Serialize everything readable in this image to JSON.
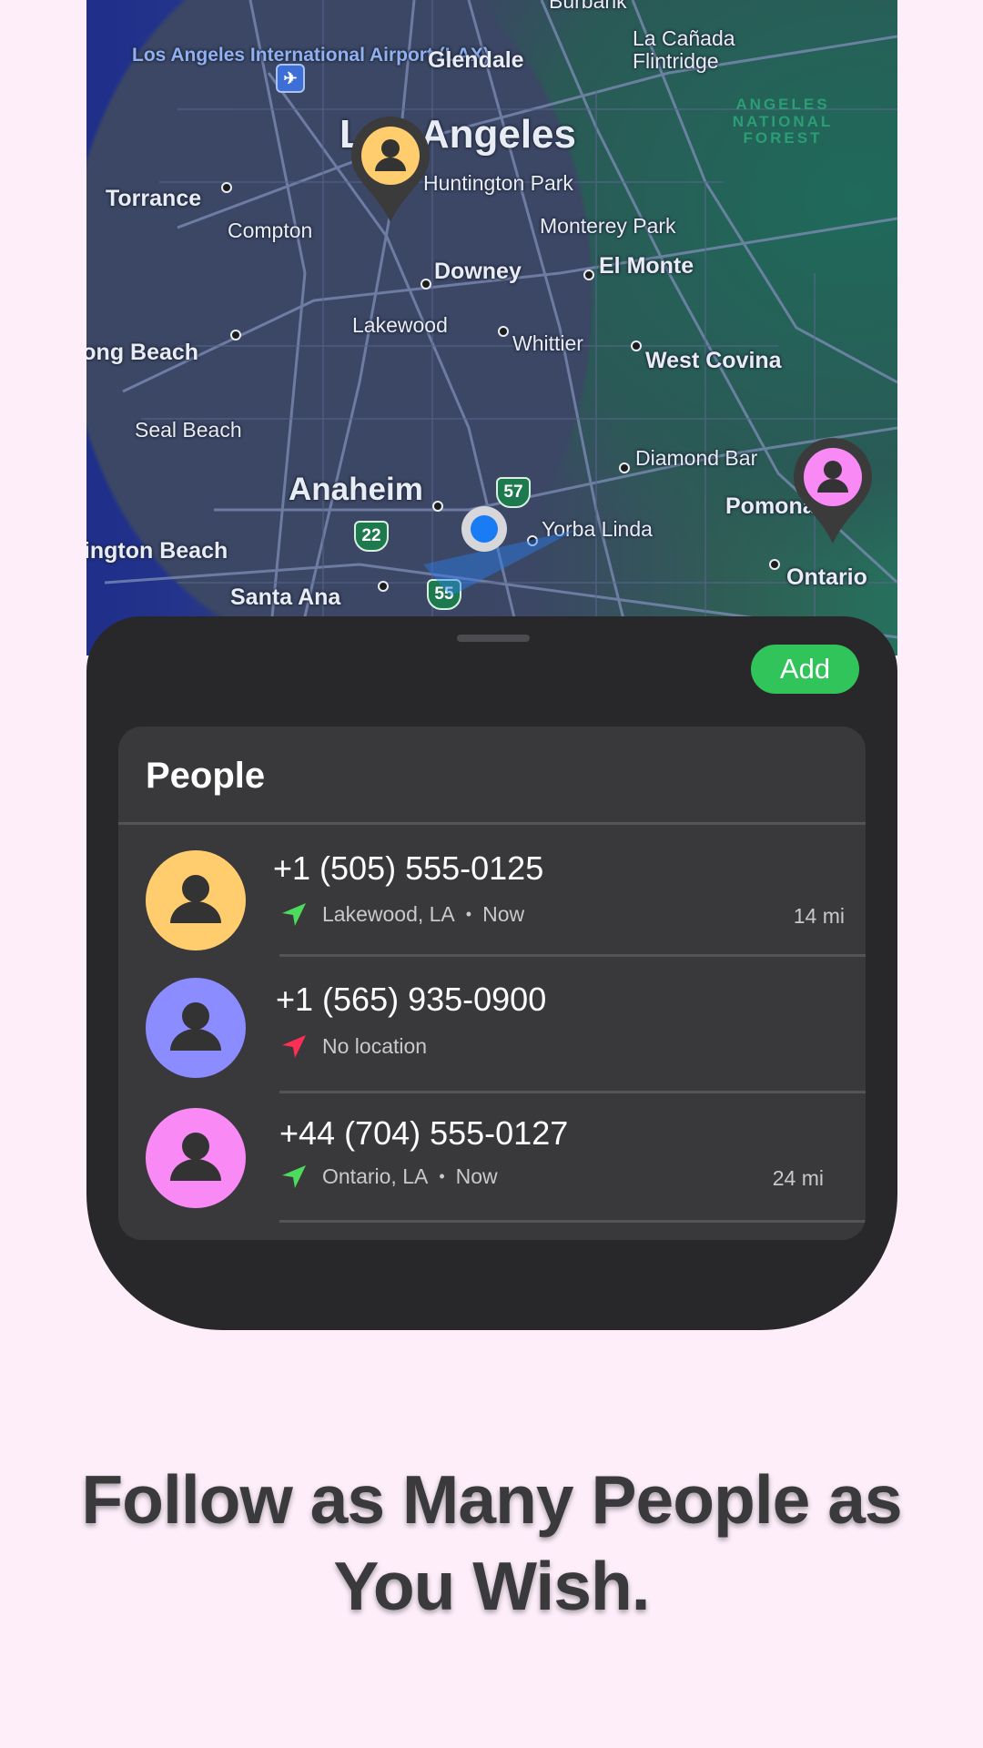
{
  "map": {
    "labels": [
      "Burbank",
      "Los Angeles International Airport (LAX)",
      "Glendale",
      "La Cañada Flintridge",
      "ANGELES NATIONAL FOREST",
      "Los Angeles",
      "Huntington Park",
      "Torrance",
      "Compton",
      "Monterey Park",
      "Downey",
      "El Monte",
      "Lakewood",
      "Whittier",
      "West Covina",
      "Long Beach",
      "Seal Beach",
      "Diamond Bar",
      "Anaheim",
      "Pomona",
      "Yorba Linda",
      "Huntington Beach",
      "Santa Ana",
      "Ontario"
    ],
    "highway_shields": [
      "57",
      "22",
      "55"
    ],
    "pins": [
      {
        "color": "#ffcc6e"
      },
      {
        "color": "#f98af5"
      }
    ],
    "current_location_color": "#1a7cf5"
  },
  "sheet": {
    "add_label": "Add",
    "add_color": "#30c45a"
  },
  "people": {
    "title": "People",
    "items": [
      {
        "phone": "+1 (505) 555-0125",
        "location": "Lakewood, LA",
        "separator": "•",
        "time": "Now",
        "distance": "14 mi",
        "avatar_color": "#ffcc6e",
        "arrow_color": "#4cdb5c"
      },
      {
        "phone": "+1 (565) 935-0900",
        "location": "No location",
        "avatar_color": "#8b8cff",
        "arrow_color": "#ff2e55"
      },
      {
        "phone": "+44 (704) 555-0127",
        "location": "Ontario, LA",
        "separator": "•",
        "time": "Now",
        "distance": "24 mi",
        "avatar_color": "#f98af5",
        "arrow_color": "#4cdb5c"
      }
    ]
  },
  "headline": {
    "line1": "Follow as Many People as",
    "line2": "You Wish."
  }
}
